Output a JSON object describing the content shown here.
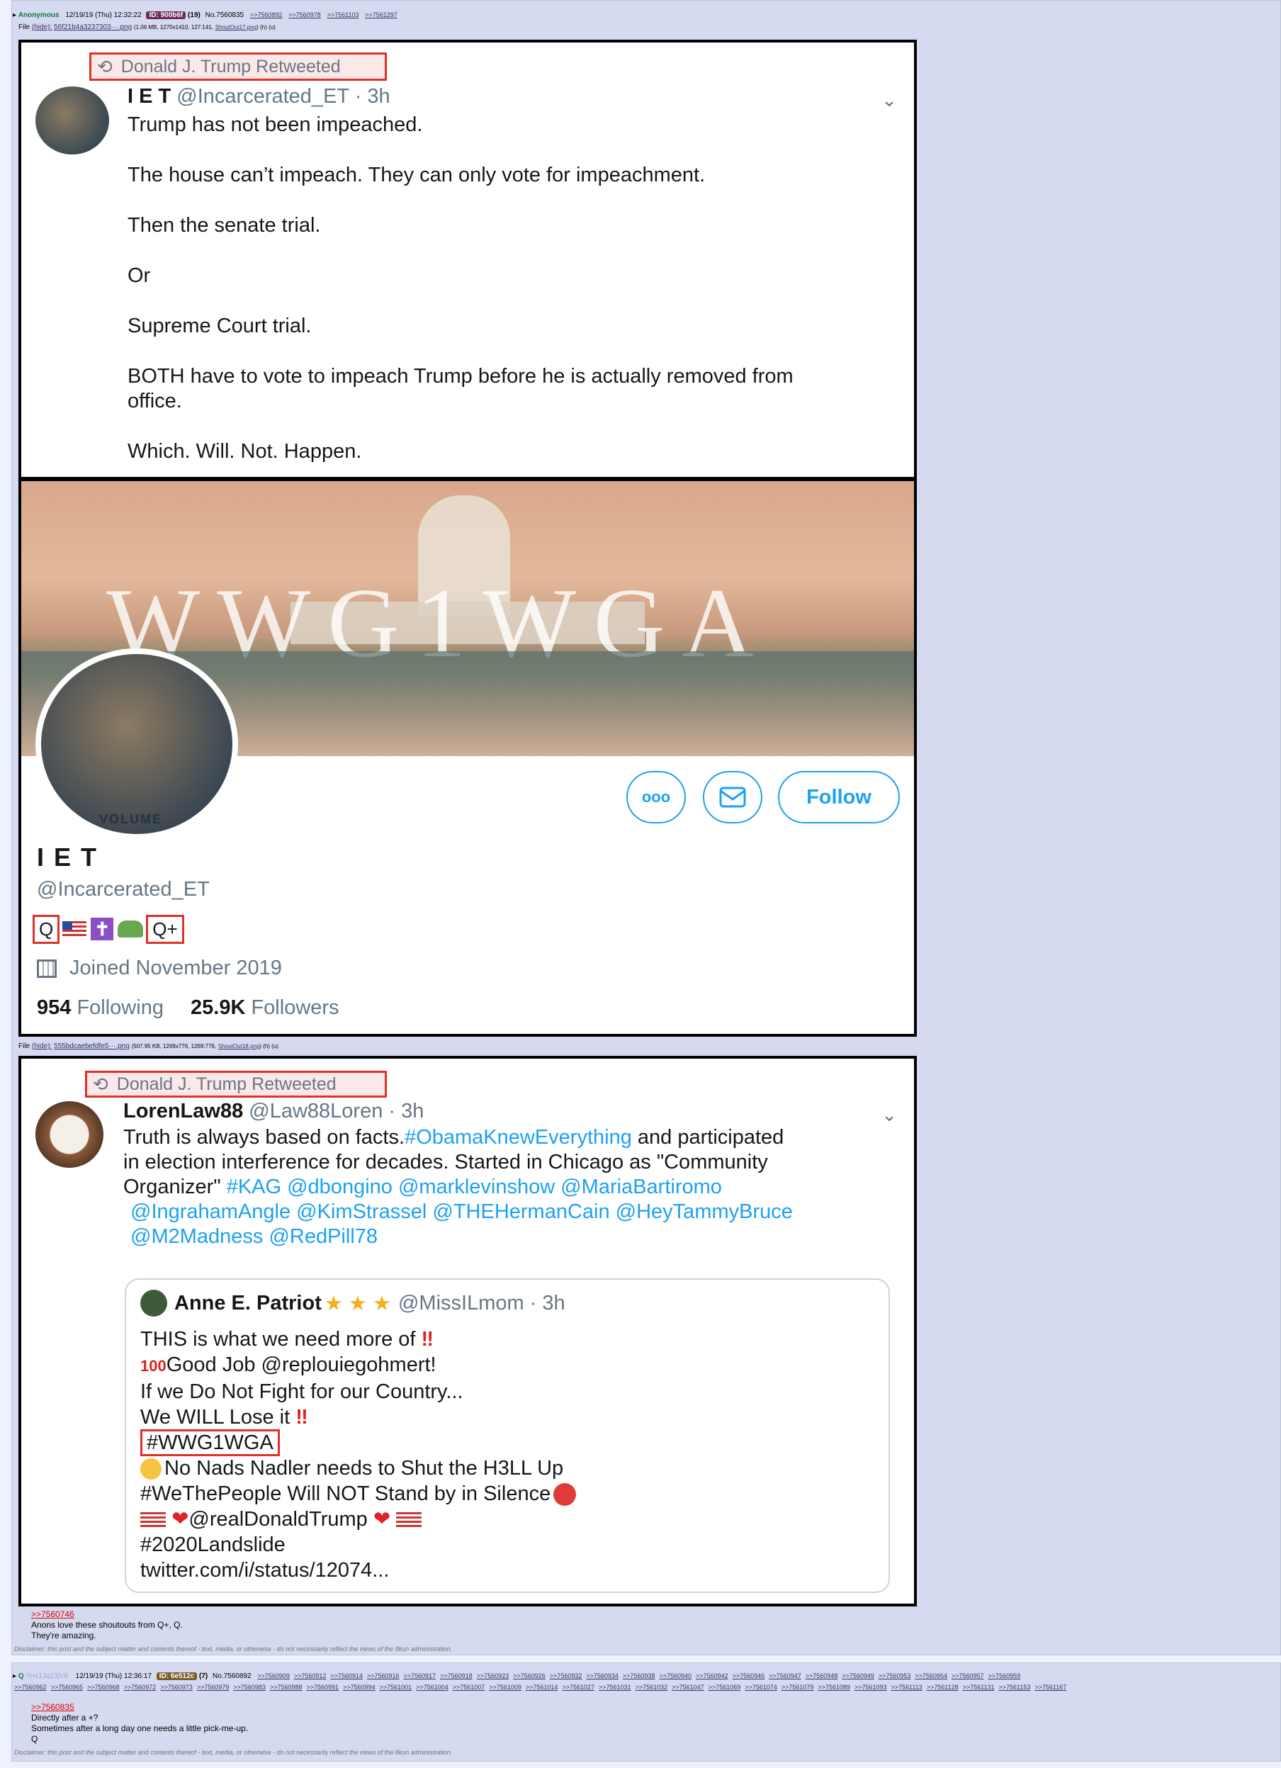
{
  "post1": {
    "name": "Anonymous",
    "datetime": "12/19/19 (Thu) 12:32:22",
    "id_label": "ID: 900b6f",
    "id_count": "(19)",
    "number": "No.7560835",
    "backlinks": [
      ">>7560892",
      ">>7560978",
      ">>7561103",
      ">>7561297"
    ],
    "file1": {
      "prefix": "File",
      "hide": "(hide):",
      "filename": "56f21b4a3237303···.png",
      "meta": "(1.06 MB, 1270x1410, 127:141,",
      "orig": "ShoutOut17.png",
      "tail": ") (h) (u)"
    },
    "file2": {
      "prefix": "File",
      "hide": "(hide):",
      "filename": "555bdcaebefdfe5···.png",
      "meta": "(507.95 KB, 1269x776, 1269:776,",
      "orig": "ShoutOut18.png",
      "tail": ") (h) (u)"
    },
    "quote_link": ">>7560746",
    "message_lines": [
      "Anons love these shoutouts from Q+, Q.",
      "They're amazing."
    ],
    "disclaimer": "Disclaimer: this post and the subject matter and contents thereof - text, media, or otherwise - do not necessarily reflect the views of the 8kun administration."
  },
  "tweet1": {
    "retweet_label": "Donald J. Trump Retweeted",
    "display_name": "I E T",
    "handle": "@Incarcerated_ET",
    "time": "· 3h",
    "lines": [
      "Trump has not been impeached.",
      "The house can’t impeach. They can only vote for impeachment.",
      "Then the senate trial.",
      "Or",
      "Supreme Court trial.",
      "BOTH have to vote to impeach Trump before he is actually removed from",
      "office.",
      "Which. Will. Not. Happen."
    ]
  },
  "profile": {
    "banner_text": "WWG1WGA",
    "avatar_text": "VOLUME",
    "name": "I E T",
    "handle": "@Incarcerated_ET",
    "badge_q": "Q",
    "badge_qplus": "Q+",
    "joined": "Joined November 2019",
    "following_count": "954",
    "following_label": "Following",
    "followers_count": "25.9K",
    "followers_label": "Followers",
    "follow_label": "Follow"
  },
  "tweet2": {
    "retweet_label": "Donald J. Trump Retweeted",
    "display_name": "LorenLaw88",
    "handle": "@Law88Loren",
    "time": "· 3h",
    "line1_plain": "Truth is always based on facts.",
    "line1_tag": "#ObamaKnewEverything",
    "line1_rest": " and participated",
    "line2": "in election interference for decades. Started in Chicago as \"Community",
    "line3_plain": "Organizer\"  ",
    "line3_tags": "#KAG @dbongino @marklevinshow @MariaBartiromo",
    "line4": "@IngrahamAngle @KimStrassel @THEHermanCain @HeyTammyBruce",
    "line5": "@M2Madness @RedPill78"
  },
  "quoted": {
    "display_name": "Anne E. Patriot",
    "handle": "@MissILmom",
    "time": "· 3h",
    "l1": "THIS is what we need more of",
    "l2": "Good Job @replouiegohmert!",
    "l3": "If we Do Not Fight for our Country...",
    "l4": "We WILL Lose it",
    "l5": "#WWG1WGA",
    "l6": "No Nads Nadler needs to Shut the H3LL Up",
    "l7": "#WeThePeople Will NOT Stand by in Silence",
    "l8": "@realDonaldTrump",
    "l9": "#2020Landslide",
    "l10": "twitter.com/i/status/12074..."
  },
  "post2": {
    "name": "Q",
    "trip": "!!Hs1Jq13jV6",
    "datetime": "12/19/19 (Thu) 12:36:17",
    "id_label": "ID: 6e512c",
    "id_count": "(7)",
    "number": "No.7560892",
    "backlinks_row1": [
      ">>7560909",
      ">>7560912",
      ">>7560914",
      ">>7560916",
      ">>7560917",
      ">>7560918",
      ">>7560923",
      ">>7560926",
      ">>7560932",
      ">>7560934",
      ">>7560938",
      ">>7560940",
      ">>7560942",
      ">>7560946",
      ">>7560947",
      ">>7560948",
      ">>7560949",
      ">>7560953",
      ">>7560954",
      ">>7560957",
      ">>7560959"
    ],
    "backlinks_row2": [
      ">>7560962",
      ">>7560965",
      ">>7560968",
      ">>7560972",
      ">>7560973",
      ">>7560979",
      ">>7560983",
      ">>7560988",
      ">>7560991",
      ">>7560994",
      ">>7561001",
      ">>7561004",
      ">>7561007",
      ">>7561009",
      ">>7561014",
      ">>7561027",
      ">>7561031",
      ">>7561032",
      ">>7561047",
      ">>7561069",
      ">>7561074",
      ">>7561079",
      ">>7561089",
      ">>7561093",
      ">>7561113",
      ">>7561128",
      ">>7561131",
      ">>7561153",
      ">>7561167"
    ],
    "quote_link": ">>7560835",
    "message_lines": [
      "Directly after a +?",
      "Sometimes after a long day one needs a little pick-me-up.",
      "Q"
    ],
    "disclaimer": "Disclaimer: this post and the subject matter and contents thereof - text, media, or otherwise - do not necessarily reflect the views of the 8kun administration."
  },
  "colors": {
    "twitter_blue": "#1da1f2",
    "highlight_red": "#e0302a",
    "post_bg": "#d6daf0",
    "page_bg": "#eef2ff",
    "name_green": "#117743"
  }
}
